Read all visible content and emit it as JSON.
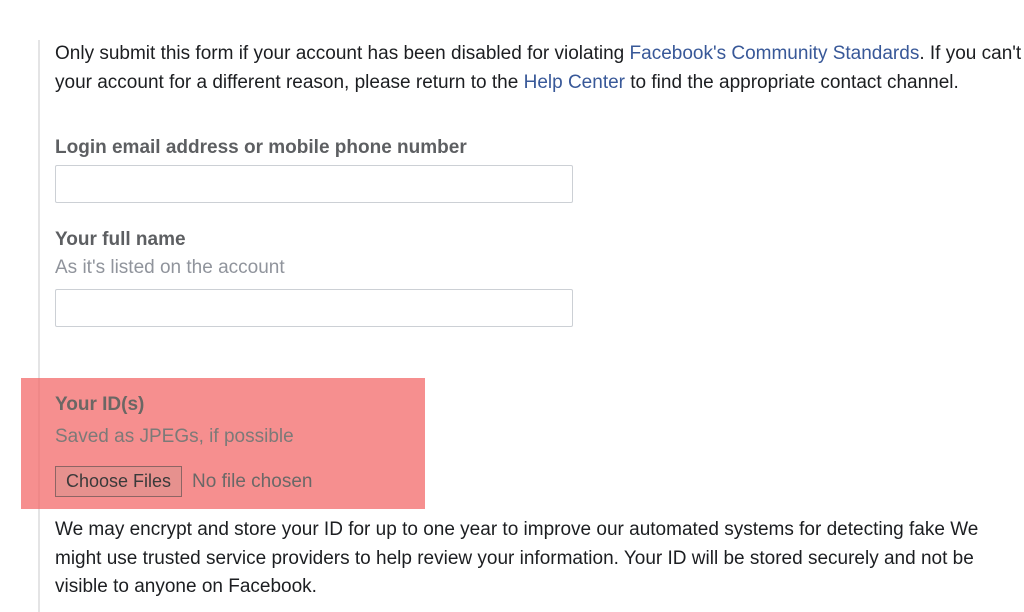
{
  "intro": {
    "text1": "Only submit this form if your account has been disabled for violating ",
    "link1": "Facebook's Community Standards",
    "text2": ". If you can't your account for a different reason, please return to the ",
    "link2": "Help Center",
    "text3": " to find the appropriate contact channel."
  },
  "emailField": {
    "label": "Login email address or mobile phone number",
    "value": ""
  },
  "nameField": {
    "label": "Your full name",
    "sublabel": "As it's listed on the account",
    "value": ""
  },
  "idField": {
    "label": "Your ID(s)",
    "sublabel": "Saved as JPEGs, if possible",
    "button": "Choose Files",
    "status": "No file chosen"
  },
  "bottomText": "We may encrypt and store your ID for up to one year to improve our automated systems for detecting fake We might use trusted service providers to help review your information. Your ID will be stored securely and not be visible to anyone on Facebook."
}
